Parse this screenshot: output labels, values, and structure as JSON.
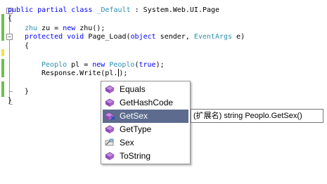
{
  "code": {
    "line1": {
      "kw": "public partial class ",
      "type": "_Default",
      "rest": " : System.Web.UI.Page"
    },
    "line2": "{",
    "line3": {
      "type": "zhu",
      "mid": " zu = ",
      "kw": "new",
      "rest": " zhu();"
    },
    "line4": {
      "kw1": "protected void",
      "mid": " Page_Load(",
      "kw2": "object",
      "mid2": " sender, ",
      "type": "EventArgs",
      "rest": " e)"
    },
    "line5": "{",
    "line6": {
      "type": "Peoplo",
      "mid": " pl = ",
      "kw": "new",
      "type2": " Peoplo",
      "mid2": "(",
      "kw2": "true",
      "rest": ");"
    },
    "line7": "Response.Write(pl.",
    "line7_end": ");",
    "line8": "}",
    "line9": "}"
  },
  "intellisense": {
    "items": [
      {
        "label": "Equals",
        "icon": "method-icon"
      },
      {
        "label": "GetHashCode",
        "icon": "method-icon"
      },
      {
        "label": "GetSex",
        "icon": "extension-method-icon",
        "selected": true
      },
      {
        "label": "GetType",
        "icon": "method-icon"
      },
      {
        "label": "Sex",
        "icon": "property-icon"
      },
      {
        "label": "ToString",
        "icon": "method-icon"
      }
    ]
  },
  "tooltip": "(扩展名) string Peoplo.GetSex()",
  "colors": {
    "keyword": "#0000ff",
    "type": "#2b91af",
    "selection": "#5d6c8e",
    "method_icon": "#a05cc0"
  }
}
